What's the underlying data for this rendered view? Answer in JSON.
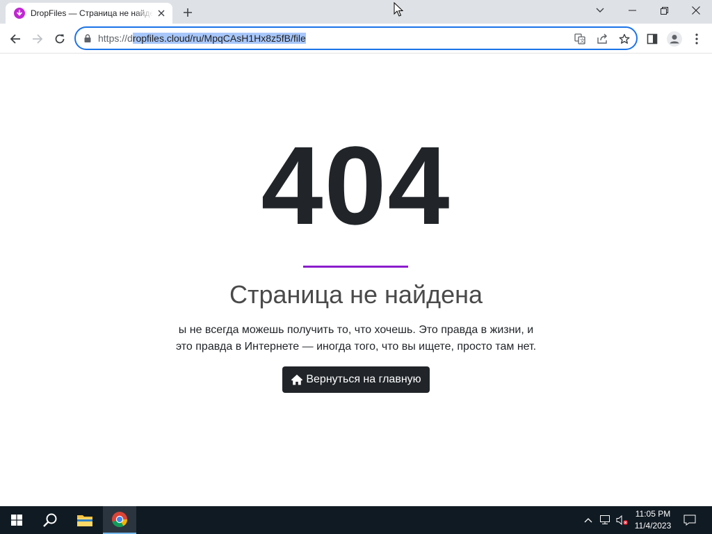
{
  "browser": {
    "tab_title": "DropFiles — Страница не найдена",
    "url_prefix": "https://d",
    "url_selected": "ropfiles.cloud/ru/MpqCAsH1Hx8z5fB/file",
    "accent_color": "#1a73e8"
  },
  "page": {
    "error_code": "404",
    "heading": "Страница не найдена",
    "description_line1": "ы не всегда можешь получить то, что хочешь. Это правда в жизни, и",
    "description_line2": "это правда в Интернете — иногда того, что вы ищете, просто там нет.",
    "home_button_label": "Вернуться на главную",
    "divider_color": "#8a1ccb"
  },
  "taskbar": {
    "time": "11:05 PM",
    "date": "11/4/2023"
  },
  "icons": [
    "dropfiles-favicon",
    "tab-close-icon",
    "new-tab-icon",
    "tab-search-icon",
    "minimize-icon",
    "restore-icon",
    "close-icon",
    "back-icon",
    "forward-icon",
    "reload-icon",
    "lock-icon",
    "translate-icon",
    "share-icon",
    "bookmark-star-icon",
    "side-panel-icon",
    "profile-icon",
    "menu-icon",
    "home-icon",
    "windows-start-icon",
    "search-icon",
    "file-explorer-icon",
    "chrome-icon",
    "chevron-up-icon",
    "network-icon",
    "volume-muted-icon",
    "notification-icon"
  ]
}
